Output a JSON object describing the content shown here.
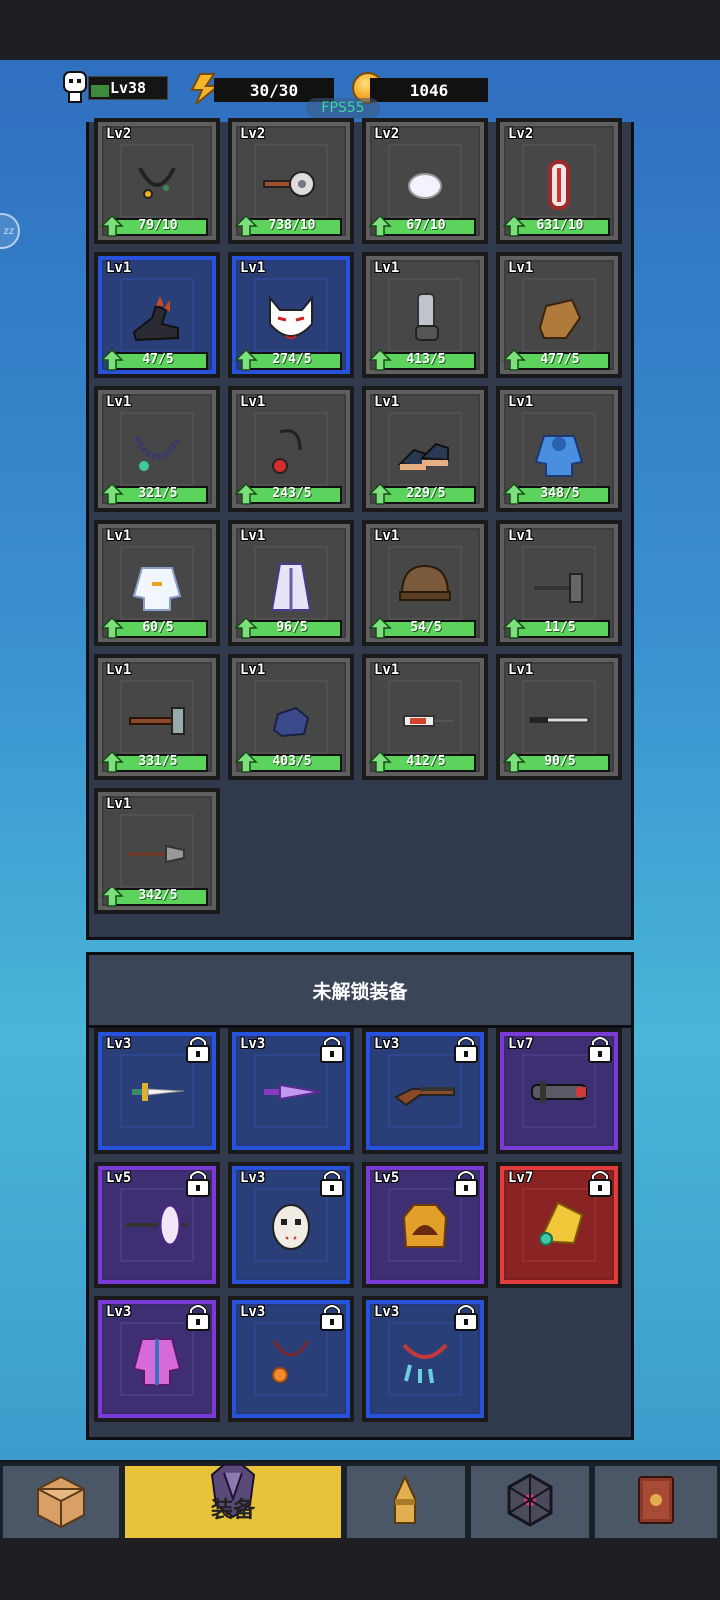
{
  "hud": {
    "level": "Lv38",
    "energy": "30/30",
    "coins": "1046",
    "fps": "FPS55",
    "side_button": "zz"
  },
  "owned_items": [
    {
      "lv": "Lv2",
      "progress": "79/10",
      "frame": "gray",
      "icon": "necklace-icon"
    },
    {
      "lv": "Lv2",
      "progress": "738/10",
      "frame": "gray",
      "icon": "spiked-mace-icon"
    },
    {
      "lv": "Lv2",
      "progress": "67/10",
      "frame": "gray",
      "icon": "stone-icon"
    },
    {
      "lv": "Lv2",
      "progress": "631/10",
      "frame": "gray",
      "icon": "shield-icon"
    },
    {
      "lv": "Lv1",
      "progress": "47/5",
      "frame": "blue",
      "icon": "spiked-boots-icon"
    },
    {
      "lv": "Lv1",
      "progress": "274/5",
      "frame": "blue",
      "icon": "fox-mask-icon"
    },
    {
      "lv": "Lv1",
      "progress": "413/5",
      "frame": "gray",
      "icon": "bracer-icon"
    },
    {
      "lv": "Lv1",
      "progress": "477/5",
      "frame": "gray",
      "icon": "glove-icon"
    },
    {
      "lv": "Lv1",
      "progress": "321/5",
      "frame": "gray",
      "icon": "bead-necklace-icon"
    },
    {
      "lv": "Lv1",
      "progress": "243/5",
      "frame": "gray",
      "icon": "red-pendant-icon"
    },
    {
      "lv": "Lv1",
      "progress": "229/5",
      "frame": "gray",
      "icon": "sneakers-icon"
    },
    {
      "lv": "Lv1",
      "progress": "348/5",
      "frame": "gray",
      "icon": "blue-hoodie-icon"
    },
    {
      "lv": "Lv1",
      "progress": "60/5",
      "frame": "gray",
      "icon": "white-jacket-icon"
    },
    {
      "lv": "Lv1",
      "progress": "96/5",
      "frame": "gray",
      "icon": "robe-icon"
    },
    {
      "lv": "Lv1",
      "progress": "54/5",
      "frame": "gray",
      "icon": "helmet-icon"
    },
    {
      "lv": "Lv1",
      "progress": "11/5",
      "frame": "gray",
      "icon": "hammer-icon"
    },
    {
      "lv": "Lv1",
      "progress": "331/5",
      "frame": "gray",
      "icon": "axe-icon"
    },
    {
      "lv": "Lv1",
      "progress": "403/5",
      "frame": "gray",
      "icon": "rock-icon"
    },
    {
      "lv": "Lv1",
      "progress": "412/5",
      "frame": "gray",
      "icon": "syringe-icon"
    },
    {
      "lv": "Lv1",
      "progress": "90/5",
      "frame": "gray",
      "icon": "katana-icon"
    },
    {
      "lv": "Lv1",
      "progress": "342/5",
      "frame": "gray",
      "icon": "shovel-icon"
    }
  ],
  "locked_section": {
    "title": "未解锁装备",
    "items": [
      {
        "lv": "Lv3",
        "frame": "blue",
        "icon": "golden-sword-icon"
      },
      {
        "lv": "Lv3",
        "frame": "blue",
        "icon": "purple-dagger-icon"
      },
      {
        "lv": "Lv3",
        "frame": "blue",
        "icon": "shotgun-icon"
      },
      {
        "lv": "Lv7",
        "frame": "purple",
        "icon": "laser-cannon-icon"
      },
      {
        "lv": "Lv5",
        "frame": "purple",
        "icon": "double-axe-icon"
      },
      {
        "lv": "Lv3",
        "frame": "blue",
        "icon": "hockey-mask-icon"
      },
      {
        "lv": "Lv5",
        "frame": "purple",
        "icon": "golden-armor-icon"
      },
      {
        "lv": "Lv7",
        "frame": "red",
        "icon": "golden-wing-icon"
      },
      {
        "lv": "Lv3",
        "frame": "purple",
        "icon": "pink-coat-icon"
      },
      {
        "lv": "Lv3",
        "frame": "blue",
        "icon": "flower-necklace-icon"
      },
      {
        "lv": "Lv3",
        "frame": "blue",
        "icon": "feather-necklace-icon"
      }
    ]
  },
  "nav": {
    "tabs": [
      {
        "icon": "box-icon",
        "label": ""
      },
      {
        "icon": "armor-icon",
        "label": "装备"
      },
      {
        "icon": "bullet-icon",
        "label": ""
      },
      {
        "icon": "rune-icon",
        "label": ""
      },
      {
        "icon": "book-icon",
        "label": ""
      }
    ]
  }
}
